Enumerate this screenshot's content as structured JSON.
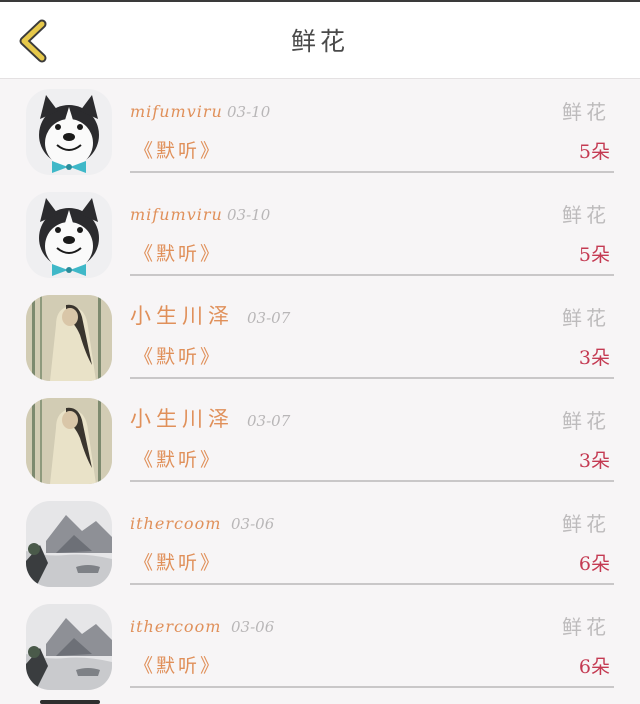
{
  "header": {
    "title": "鲜花",
    "back_icon": "chevron-left-icon"
  },
  "colors": {
    "accent": "#e0905a",
    "count": "#c43a52",
    "back": "#e6c84a"
  },
  "items": [
    {
      "user": "mifumviru",
      "date": "03-10",
      "song": "《默听》",
      "gift": "鲜花",
      "count": "5朵",
      "avatar": "husky-avatar"
    },
    {
      "user": "mifumviru",
      "date": "03-10",
      "song": "《默听》",
      "gift": "鲜花",
      "count": "5朵",
      "avatar": "husky-avatar"
    },
    {
      "user": "小生川泽",
      "date": "03-07",
      "song": "《默听》",
      "gift": "鲜花",
      "count": "3朵",
      "avatar": "painting-avatar"
    },
    {
      "user": "小生川泽",
      "date": "03-07",
      "song": "《默听》",
      "gift": "鲜花",
      "count": "3朵",
      "avatar": "painting-avatar"
    },
    {
      "user": "ithercoom",
      "date": "03-06",
      "song": "《默听》",
      "gift": "鲜花",
      "count": "6朵",
      "avatar": "landscape-avatar"
    },
    {
      "user": "ithercoom",
      "date": "03-06",
      "song": "《默听》",
      "gift": "鲜花",
      "count": "6朵",
      "avatar": "landscape-avatar"
    }
  ]
}
